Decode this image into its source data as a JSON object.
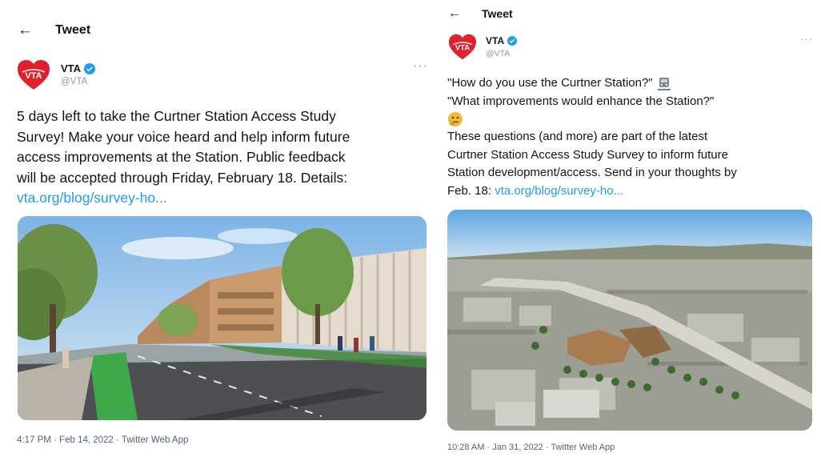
{
  "tweet_left": {
    "header": {
      "back_icon": "arrow-left-icon",
      "title": "Tweet"
    },
    "author": {
      "name": "VTA",
      "handle": "@VTA",
      "avatar_logo": "VTA"
    },
    "body": {
      "lines": [
        "5 days left to take the Curtner Station Access Study",
        "Survey! Make your voice heard and help inform future",
        "access improvements at the Station. Public feedback",
        "will be accepted through Friday, February 18. Details:"
      ],
      "link": "vta.org/blog/survey-ho..."
    },
    "image": {
      "subject": "street-rendering"
    },
    "timestamp": "4:17 PM · Feb 14, 2022 · Twitter Web App"
  },
  "tweet_right": {
    "header": {
      "back_icon": "arrow-left-icon",
      "title": "Tweet"
    },
    "author": {
      "name": "VTA",
      "handle": "@VTA",
      "avatar_logo": "VTA"
    },
    "body": {
      "line1": "\"How do you use the Curtner Station?\"",
      "line2": "\"What improvements would enhance the Station?\"",
      "line4": "These questions (and more) are part of the latest",
      "line5": "Curtner Station Access Study Survey to inform future",
      "line6": "Station development/access. Send in your thoughts by",
      "line7_prefix": "Feb. 18: ",
      "link": "vta.org/blog/survey-ho..."
    },
    "image": {
      "subject": "aerial-rendering"
    },
    "timestamp": "10:28 AM · Jan 31, 2022 · Twitter Web App"
  },
  "colors": {
    "link": "#1d9bf0",
    "verified": "#1d9bf0",
    "avatar_heart": "#e0212b",
    "avatar_text": "#ffffff",
    "secondary_text": "#536471"
  }
}
